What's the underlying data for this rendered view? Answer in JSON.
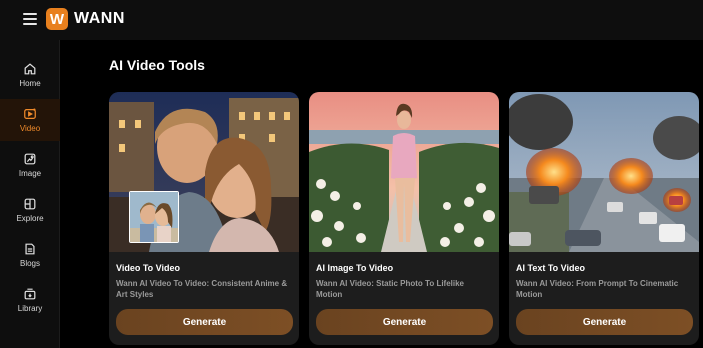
{
  "app": {
    "name": "WANN",
    "logo_letter": "W",
    "accent": "#e8801e"
  },
  "nav": [
    {
      "label": "Home",
      "icon": "home-icon"
    },
    {
      "label": "Video",
      "icon": "video-icon",
      "active": true
    },
    {
      "label": "Image",
      "icon": "image-icon"
    },
    {
      "label": "Explore",
      "icon": "explore-icon"
    },
    {
      "label": "Blogs",
      "icon": "blog-icon"
    },
    {
      "label": "Library",
      "icon": "library-icon"
    }
  ],
  "main": {
    "title": "AI Video Tools",
    "cards": [
      {
        "title": "Video To Video",
        "desc": "Wann AI Video To Video: Consistent Anime & Art Styles",
        "button": "Generate"
      },
      {
        "title": "AI Image To Video",
        "desc": "Wann AI Video: Static Photo To Lifelike Motion",
        "button": "Generate"
      },
      {
        "title": "AI Text To Video",
        "desc": "Wann AI Video: From Prompt To Cinematic Motion",
        "button": "Generate"
      }
    ]
  }
}
